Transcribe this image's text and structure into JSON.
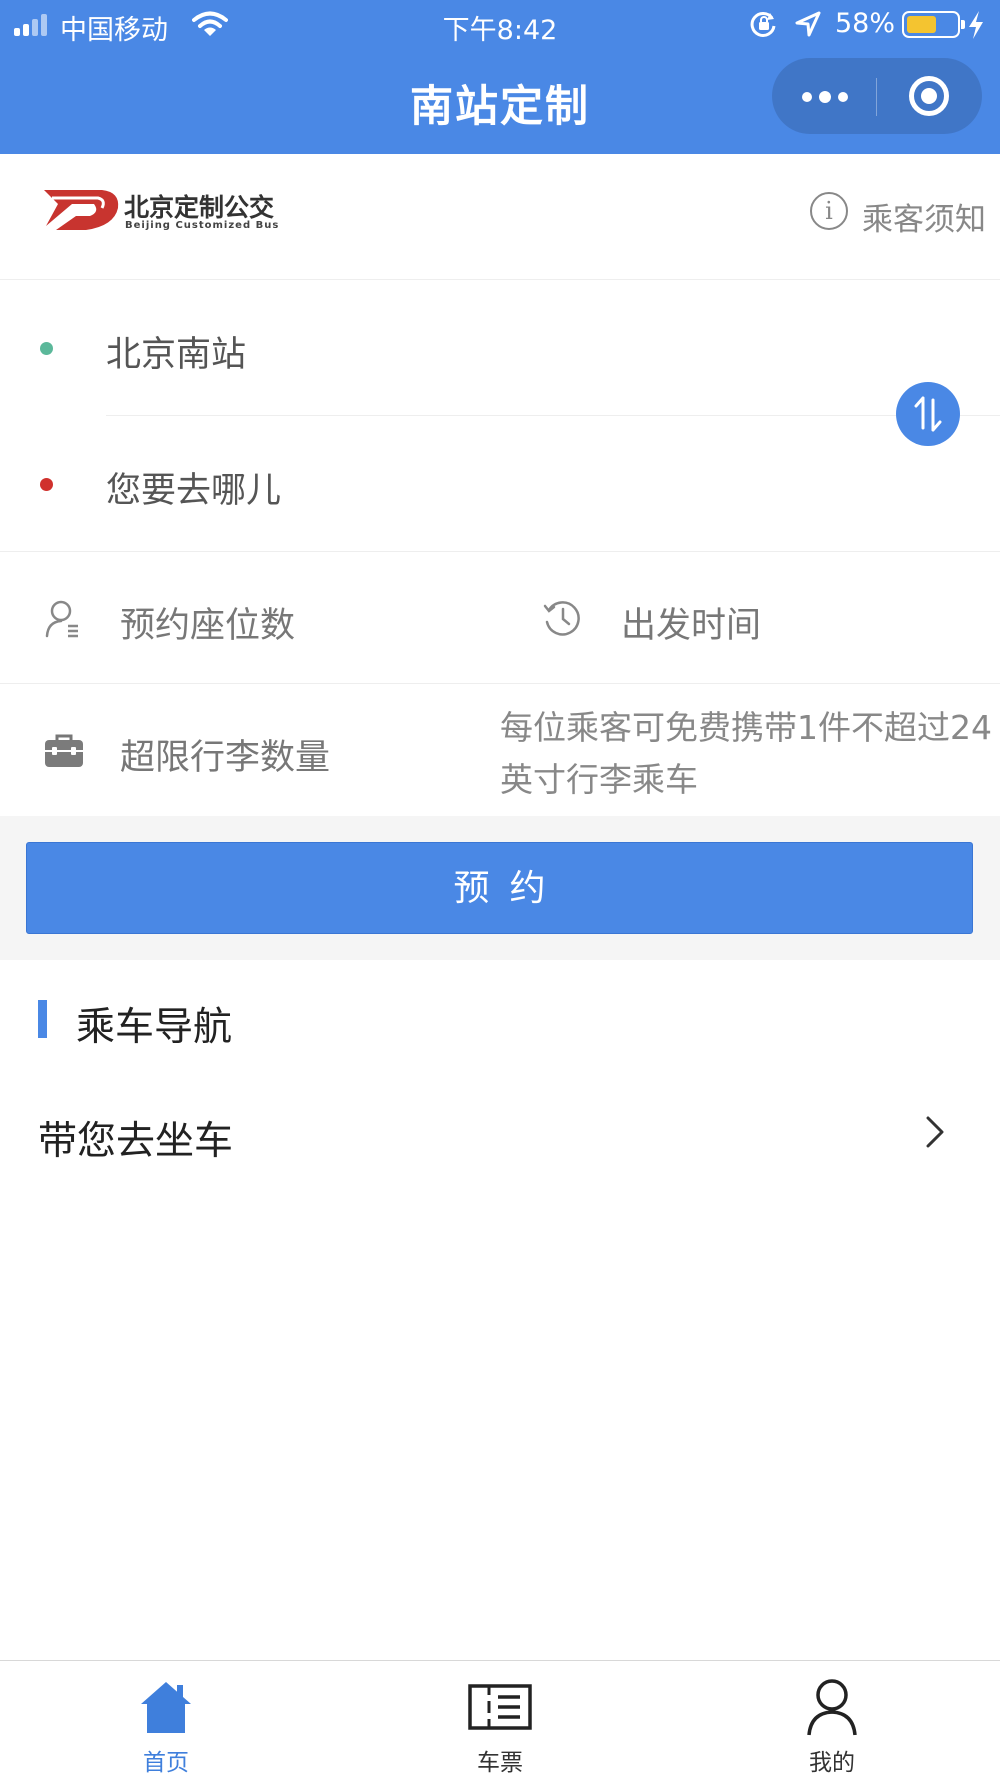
{
  "status_bar": {
    "carrier": "中国移动",
    "time": "下午8:42",
    "battery_percent": "58%",
    "battery_level": 0.58
  },
  "header": {
    "title": "南站定制",
    "more_icon": "more-dots-icon",
    "close_icon": "target-circle-icon",
    "background_color": "#4a88e5"
  },
  "brand": {
    "logo_name": "北京定制公交",
    "logo_subtitle": "Beijing Customized Bus",
    "notice_label": "乘客须知",
    "notice_icon": "info-icon"
  },
  "route": {
    "origin": "北京南站",
    "destination_placeholder": "您要去哪儿",
    "origin_dot_color": "#5bb89a",
    "destination_dot_color": "#d0312d",
    "swap_icon": "swap-icon"
  },
  "options": {
    "seats_label": "预约座位数",
    "seats_icon": "person-list-icon",
    "departure_label": "出发时间",
    "departure_icon": "clock-history-icon",
    "luggage_label": "超限行李数量",
    "luggage_icon": "suitcase-icon",
    "luggage_note": "每位乘客可免费携带1件不超过24英寸行李乘车"
  },
  "book_button": {
    "label": "预约"
  },
  "guide": {
    "section_title": "乘车导航",
    "item_label": "带您去坐车",
    "item_icon": "chevron-right-icon"
  },
  "tabbar": {
    "active_color": "#3f7fdc",
    "tabs": [
      {
        "label": "首页",
        "icon": "home-icon",
        "active": true
      },
      {
        "label": "车票",
        "icon": "ticket-icon",
        "active": false
      },
      {
        "label": "我的",
        "icon": "user-icon",
        "active": false
      }
    ]
  }
}
